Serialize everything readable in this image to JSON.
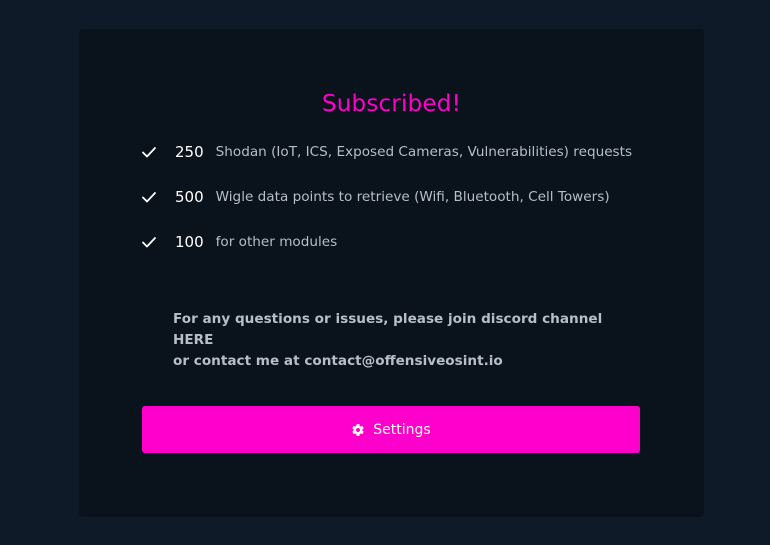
{
  "card": {
    "title": "Subscribed!",
    "features": [
      {
        "count": "250",
        "desc": "Shodan (IoT, ICS, Exposed Cameras, Vulnerabilities) requests"
      },
      {
        "count": "500",
        "desc": "Wigle data points to retrieve (Wifi, Bluetooth, Cell Towers)"
      },
      {
        "count": "100",
        "desc": "for other modules"
      }
    ],
    "contact_line1": "For any questions or issues, please join discord channel HERE",
    "contact_line2": "or contact me at contact@offensiveosint.io",
    "button_label": "Settings",
    "button_icon": "gear-icon",
    "check_icon": "check-icon"
  },
  "colors": {
    "page_bg": "#0e1a27",
    "card_bg": "#0a121b",
    "accent": "#ff00cc",
    "text_primary": "#ffffff",
    "text_secondary": "#b7bec7"
  }
}
